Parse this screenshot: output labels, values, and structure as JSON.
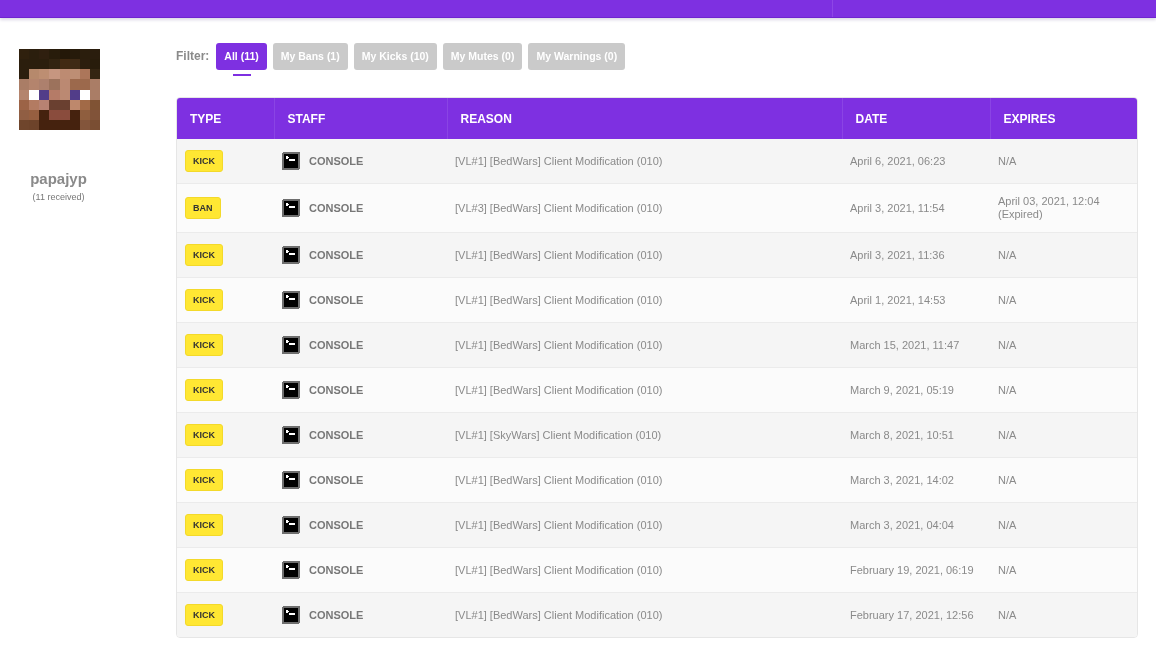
{
  "profile": {
    "username": "papajyp",
    "received": "(11 received)"
  },
  "filter": {
    "label": "Filter:",
    "options": [
      {
        "label": "All (11)",
        "selected": true
      },
      {
        "label": "My Bans (1)",
        "selected": false
      },
      {
        "label": "My Kicks (10)",
        "selected": false
      },
      {
        "label": "My Mutes (0)",
        "selected": false
      },
      {
        "label": "My Warnings (0)",
        "selected": false
      }
    ]
  },
  "table": {
    "columns": [
      "TYPE",
      "STAFF",
      "REASON",
      "DATE",
      "EXPIRES"
    ],
    "rows": [
      {
        "type": "KICK",
        "staff": "CONSOLE",
        "reason": "[VL#1] [BedWars] Client Modification (010)",
        "date": "April 6, 2021, 06:23",
        "expires": "N/A"
      },
      {
        "type": "BAN",
        "staff": "CONSOLE",
        "reason": "[VL#3] [BedWars] Client Modification (010)",
        "date": "April 3, 2021, 11:54",
        "expires": "April 03, 2021, 12:04 (Expired)"
      },
      {
        "type": "KICK",
        "staff": "CONSOLE",
        "reason": "[VL#1] [BedWars] Client Modification (010)",
        "date": "April 3, 2021, 11:36",
        "expires": "N/A"
      },
      {
        "type": "KICK",
        "staff": "CONSOLE",
        "reason": "[VL#1] [BedWars] Client Modification (010)",
        "date": "April 1, 2021, 14:53",
        "expires": "N/A"
      },
      {
        "type": "KICK",
        "staff": "CONSOLE",
        "reason": "[VL#1] [BedWars] Client Modification (010)",
        "date": "March 15, 2021, 11:47",
        "expires": "N/A"
      },
      {
        "type": "KICK",
        "staff": "CONSOLE",
        "reason": "[VL#1] [BedWars] Client Modification (010)",
        "date": "March 9, 2021, 05:19",
        "expires": "N/A"
      },
      {
        "type": "KICK",
        "staff": "CONSOLE",
        "reason": "[VL#1] [SkyWars] Client Modification (010)",
        "date": "March 8, 2021, 10:51",
        "expires": "N/A"
      },
      {
        "type": "KICK",
        "staff": "CONSOLE",
        "reason": "[VL#1] [BedWars] Client Modification (010)",
        "date": "March 3, 2021, 14:02",
        "expires": "N/A"
      },
      {
        "type": "KICK",
        "staff": "CONSOLE",
        "reason": "[VL#1] [BedWars] Client Modification (010)",
        "date": "March 3, 2021, 04:04",
        "expires": "N/A"
      },
      {
        "type": "KICK",
        "staff": "CONSOLE",
        "reason": "[VL#1] [BedWars] Client Modification (010)",
        "date": "February 19, 2021, 06:19",
        "expires": "N/A"
      },
      {
        "type": "KICK",
        "staff": "CONSOLE",
        "reason": "[VL#1] [BedWars] Client Modification (010)",
        "date": "February 17, 2021, 12:56",
        "expires": "N/A"
      }
    ]
  }
}
